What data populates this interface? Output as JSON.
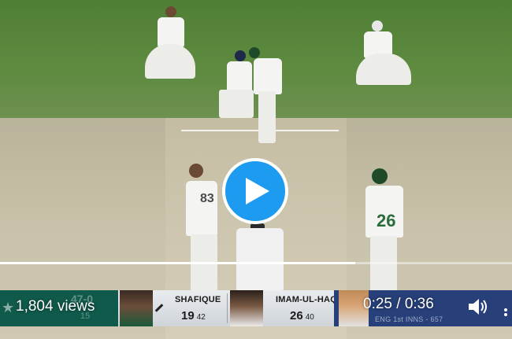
{
  "video": {
    "play_label": "Play video",
    "progress_fraction": 0.694,
    "views_text": "1,804 views",
    "time_text": "0:25 / 0:36",
    "volume_icon": "volume-icon"
  },
  "scoreboard": {
    "team_score_big": "47-0",
    "team_score_small": "15",
    "batter1": {
      "name": "SHAFIQUE",
      "runs": "19",
      "balls": "42"
    },
    "batter2": {
      "name": "IMAM-UL-HAQ",
      "runs": "26",
      "balls": "40"
    },
    "bowler_panel": {
      "innings_text": "ENG 1st INNS - 657"
    }
  },
  "on_field": {
    "jersey_bowler": "83",
    "jersey_batter": "26"
  },
  "colors": {
    "play_button": "#1d9bf0",
    "pak_green": "#0f5a4a",
    "eng_blue": "#27407a"
  }
}
